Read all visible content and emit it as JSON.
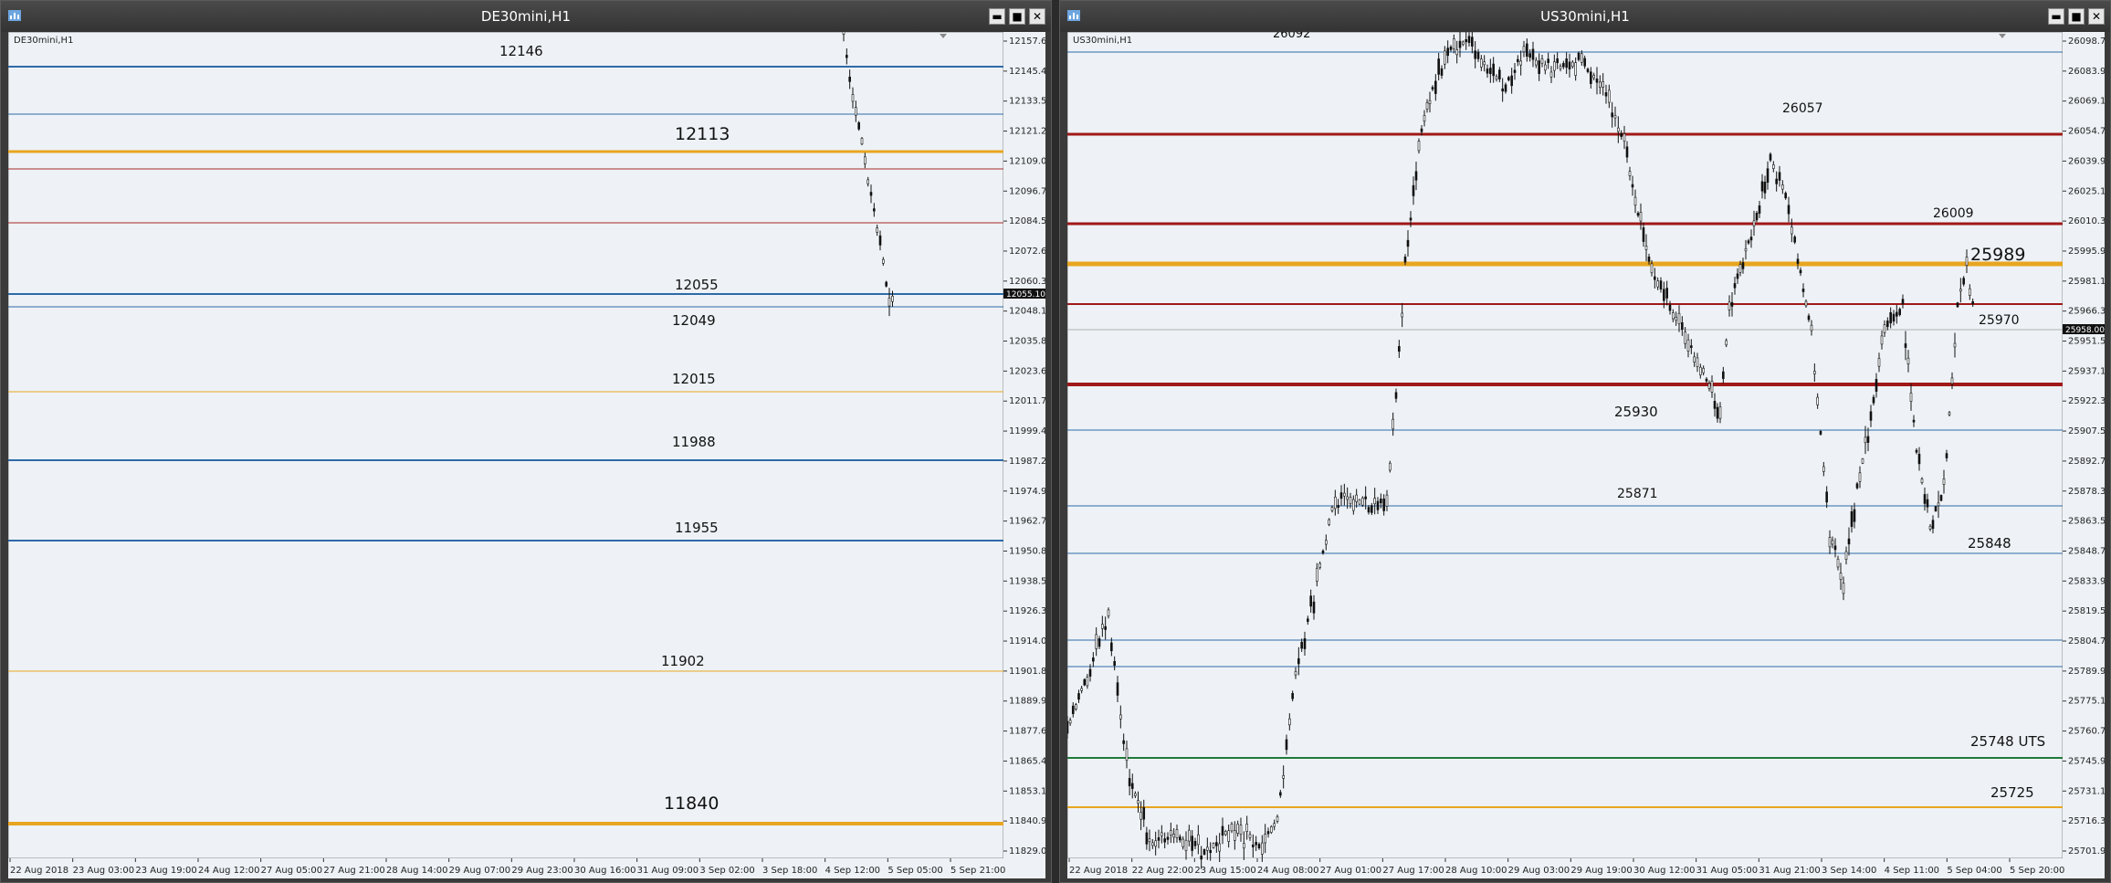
{
  "left": {
    "title": "DE30mini,H1",
    "symbol_label": "DE30mini,H1",
    "price_ticks": [
      "12157.67",
      "12145.42",
      "12133.52",
      "12121.27",
      "12109.02",
      "12096.77",
      "12084.52",
      "12072.62",
      "12060.37",
      "12048.12",
      "12035.87",
      "12023.62",
      "12011.72",
      "11999.47",
      "11987.22",
      "11974.97",
      "11962.72",
      "11950.82",
      "11938.57",
      "11926.32",
      "11914.07",
      "11901.82",
      "11889.92",
      "11877.67",
      "11865.42",
      "11853.17",
      "11840.92",
      "11829.02"
    ],
    "current_price": "12055.10",
    "time_ticks": [
      "22 Aug 2018",
      "23 Aug 03:00",
      "23 Aug 19:00",
      "24 Aug 12:00",
      "27 Aug 05:00",
      "27 Aug 21:00",
      "28 Aug 14:00",
      "29 Aug 07:00",
      "29 Aug 23:00",
      "30 Aug 16:00",
      "31 Aug 09:00",
      "3 Sep 02:00",
      "3 Sep 18:00",
      "4 Sep 12:00",
      "5 Sep 05:00",
      "5 Sep 21:00"
    ],
    "level_labels": [
      "12146",
      "12113",
      "12055",
      "12049",
      "12015",
      "11988",
      "11955",
      "11902",
      "11840"
    ],
    "colors": {
      "blue": "#2e6aa8",
      "orange": "#e8a520",
      "red": "#a52a2a"
    }
  },
  "right": {
    "title": "US30mini,H1",
    "symbol_label": "US30mini,H1",
    "price_ticks": [
      "26098.73",
      "26083.93",
      "26069.13",
      "26054.73",
      "26039.93",
      "26025.13",
      "26010.33",
      "25995.93",
      "25981.13",
      "25966.33",
      "25951.53",
      "25937.13",
      "25922.33",
      "25907.53",
      "25892.73",
      "25878.33",
      "25863.53",
      "25848.73",
      "25833.93",
      "25819.53",
      "25804.73",
      "25789.93",
      "25775.13",
      "25760.73",
      "25745.93",
      "25731.13",
      "25716.33",
      "25701.93"
    ],
    "current_price": "25958.00",
    "time_ticks": [
      "22 Aug 2018",
      "22 Aug 22:00",
      "23 Aug 15:00",
      "24 Aug 08:00",
      "27 Aug 01:00",
      "27 Aug 17:00",
      "28 Aug 10:00",
      "29 Aug 03:00",
      "29 Aug 19:00",
      "30 Aug 12:00",
      "31 Aug 05:00",
      "31 Aug 21:00",
      "3 Sep 14:00",
      "4 Sep 11:00",
      "5 Sep 04:00",
      "5 Sep 20:00"
    ],
    "level_labels": [
      "26092",
      "26057",
      "26009",
      "25989",
      "25970",
      "25930",
      "25871",
      "25848",
      "25748 UTS",
      "25725"
    ],
    "colors": {
      "blue": "#2e6aa8",
      "orange": "#e8a520",
      "red": "#a01818",
      "green": "#1f7a3a"
    }
  }
}
